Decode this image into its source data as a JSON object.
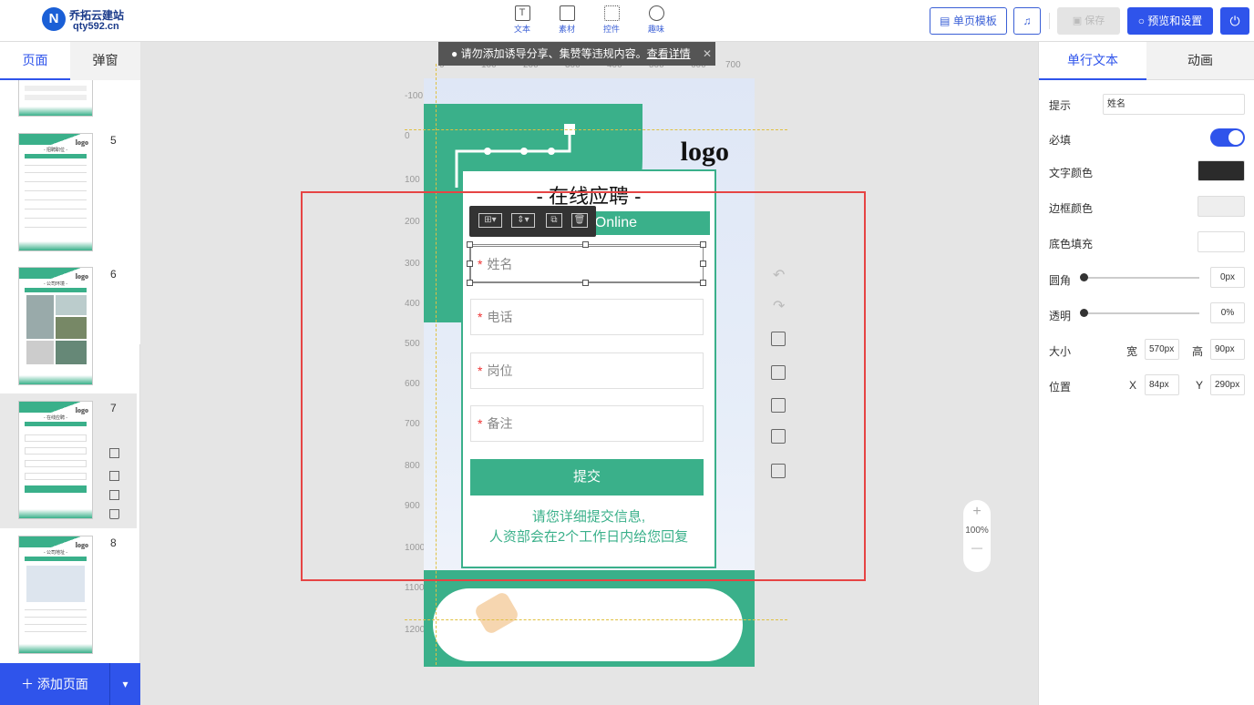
{
  "brand": {
    "mark": "N",
    "name": "乔拓云建站",
    "domain": "qty592.cn"
  },
  "toolbar": {
    "tools": [
      {
        "label": "文本",
        "icon": "text-icon"
      },
      {
        "label": "素材",
        "icon": "image-icon"
      },
      {
        "label": "控件",
        "icon": "widgets-icon"
      },
      {
        "label": "趣味",
        "icon": "bulb-icon"
      }
    ],
    "template_label": "单页模板",
    "music_icon": "♫",
    "save_label": "保存",
    "preview_label": "预览和设置",
    "power_icon": "⏻"
  },
  "left_panel": {
    "tabs": [
      "页面",
      "弹窗"
    ],
    "active_tab": 0,
    "pages": [
      {
        "num": "5",
        "title": "- 招聘职位 -",
        "sub": "Recruitment Position"
      },
      {
        "num": "6",
        "title": "- 公司环境 -",
        "sub": "Corporate Environment"
      },
      {
        "num": "7",
        "title": "- 在线应聘 -",
        "sub": "Apply Online"
      },
      {
        "num": "8",
        "title": "- 公司地址 -",
        "sub": "Company Address"
      }
    ],
    "add_page_label": "＋ 添加页面",
    "add_arrow": "▾"
  },
  "notice": {
    "text": "请勿添加诱导分享、集赞等违规内容。",
    "link": "查看详情",
    "close": "✕"
  },
  "ruler": {
    "h_ticks": [
      "0",
      "100",
      "200",
      "300",
      "400",
      "500",
      "600",
      "700"
    ],
    "v_ticks": [
      "-100",
      "0",
      "100",
      "200",
      "300",
      "400",
      "500",
      "600",
      "700",
      "800",
      "900",
      "1000",
      "1100",
      "1200"
    ]
  },
  "poster": {
    "logo": "logo",
    "title": "- 在线应聘 -",
    "subtitle": "Online",
    "fields": [
      {
        "label": "姓名",
        "required": "*"
      },
      {
        "label": "电话",
        "required": "*"
      },
      {
        "label": "岗位",
        "required": "*"
      },
      {
        "label": "备注",
        "required": "*"
      }
    ],
    "submit": "提交",
    "note_line1": "请您详细提交信息,",
    "note_line2": "人资部会在2个工作日内给您回复"
  },
  "element_toolbar": [
    "⊞▾",
    "⇕▾",
    "⧉",
    "🗑"
  ],
  "zoom": {
    "plus": "+",
    "level": "100%",
    "minus": "—"
  },
  "right_panel": {
    "tabs": [
      "单行文本",
      "动画"
    ],
    "active_tab": 0,
    "hint_label": "提示",
    "hint_value": "姓名",
    "required_label": "必填",
    "required_on": true,
    "text_color_label": "文字颜色",
    "text_color": "#2b2b2b",
    "border_color_label": "边框颜色",
    "border_color": "#eeeeee",
    "fill_label": "底色填充",
    "fill_color": "#ffffff",
    "radius_label": "圆角",
    "radius_value": "0px",
    "opacity_label": "透明",
    "opacity_value": "0%",
    "size_label": "大小",
    "width_label": "宽",
    "width_value": "570px",
    "height_label": "高",
    "height_value": "90px",
    "pos_label": "位置",
    "x_label": "X",
    "x_value": "84px",
    "y_label": "Y",
    "y_value": "290px"
  },
  "colors": {
    "accent": "#2f54eb",
    "poster_green": "#3ab08a",
    "selection": "#e64444"
  }
}
